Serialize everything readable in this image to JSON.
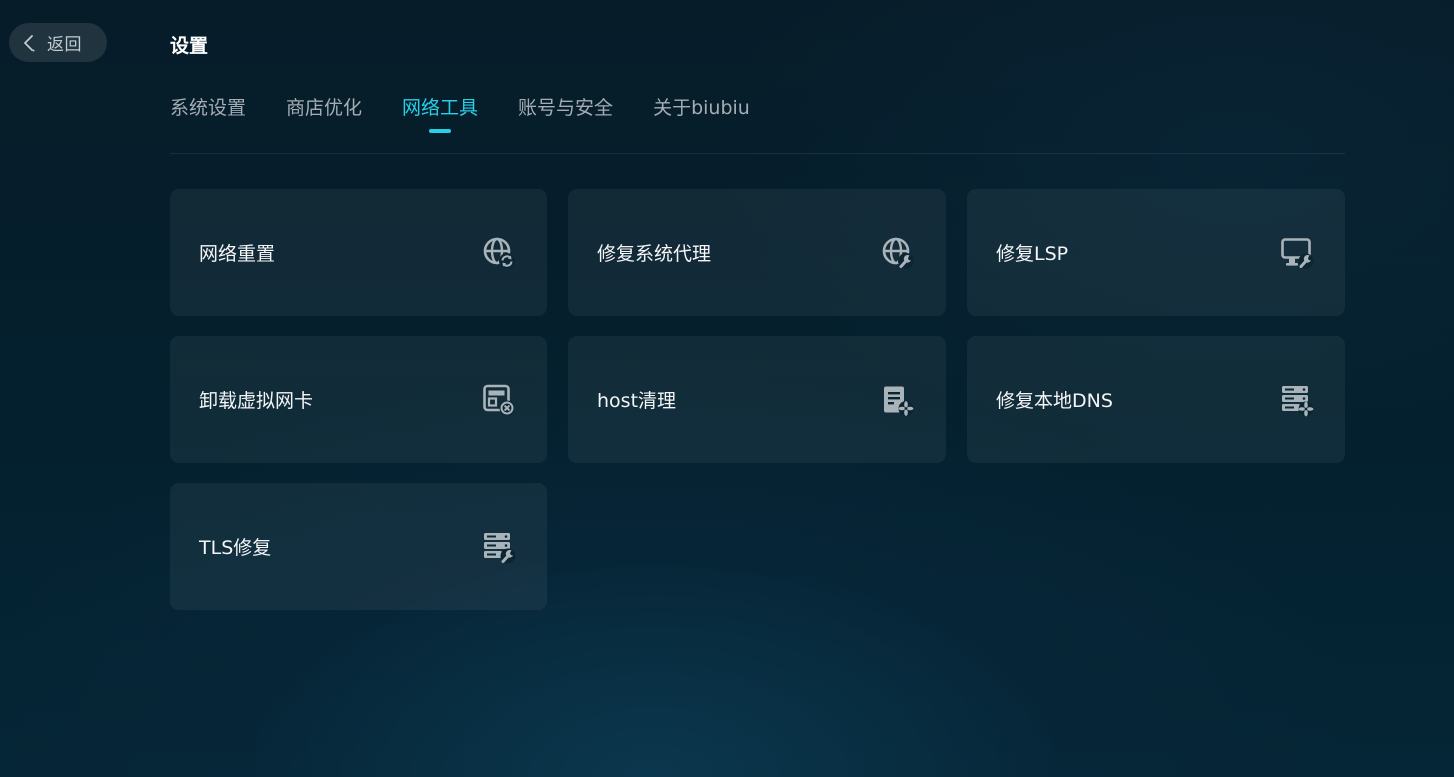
{
  "header": {
    "back_label": "返回",
    "title": "设置"
  },
  "tabs": [
    {
      "label": "系统设置",
      "active": false
    },
    {
      "label": "商店优化",
      "active": false
    },
    {
      "label": "网络工具",
      "active": true
    },
    {
      "label": "账号与安全",
      "active": false
    },
    {
      "label": "关于biubiu",
      "active": false
    }
  ],
  "tools": [
    {
      "label": "网络重置",
      "icon": "globe-refresh-icon"
    },
    {
      "label": "修复系统代理",
      "icon": "globe-wrench-icon"
    },
    {
      "label": "修复LSP",
      "icon": "monitor-wrench-icon"
    },
    {
      "label": "卸载虚拟网卡",
      "icon": "network-card-remove-icon"
    },
    {
      "label": "host清理",
      "icon": "document-fan-icon"
    },
    {
      "label": "修复本地DNS",
      "icon": "server-fan-icon"
    },
    {
      "label": "TLS修复",
      "icon": "server-wrench-icon"
    }
  ],
  "colors": {
    "accent": "#27d0e8",
    "icon": "#a9b3ba"
  }
}
